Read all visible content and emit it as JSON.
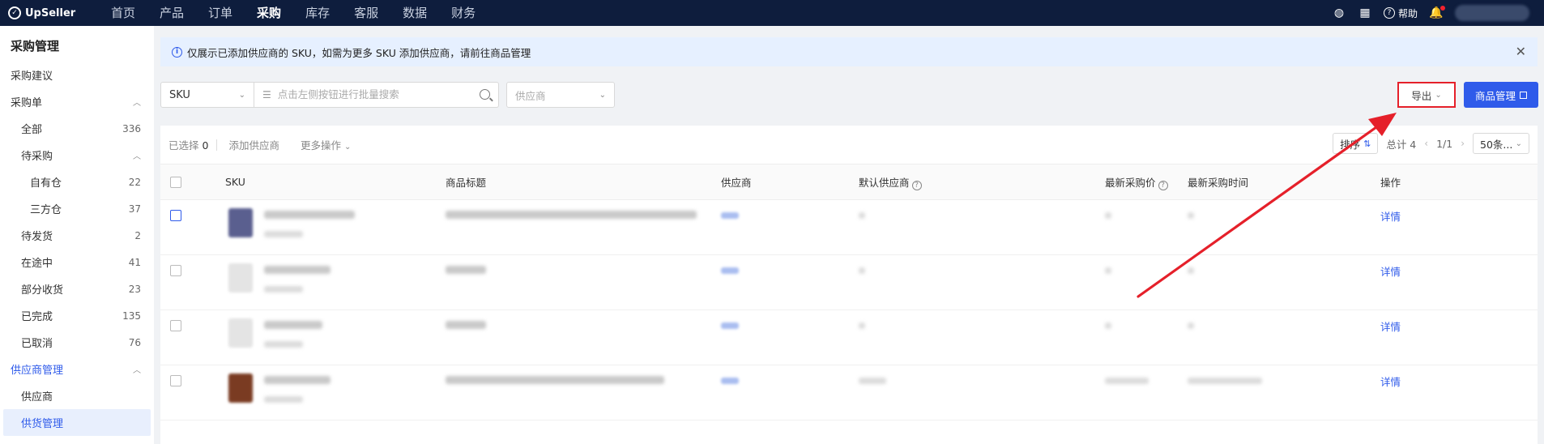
{
  "app": {
    "brand": "UpSeller"
  },
  "topnav": {
    "items": [
      "首页",
      "产品",
      "订单",
      "采购",
      "库存",
      "客服",
      "数据",
      "财务"
    ],
    "active_index": 3,
    "help_label": "帮助"
  },
  "sidebar": {
    "title": "采购管理",
    "items": [
      {
        "label": "采购建议",
        "count": "",
        "level": 1
      },
      {
        "label": "采购单",
        "count": "",
        "level": 1,
        "chevron": "up"
      },
      {
        "label": "全部",
        "count": "336",
        "level": 2
      },
      {
        "label": "待采购",
        "count": "",
        "level": 2,
        "chevron": "up"
      },
      {
        "label": "自有仓",
        "count": "22",
        "level": 3
      },
      {
        "label": "三方仓",
        "count": "37",
        "level": 3
      },
      {
        "label": "待发货",
        "count": "2",
        "level": 2
      },
      {
        "label": "在途中",
        "count": "41",
        "level": 2
      },
      {
        "label": "部分收货",
        "count": "23",
        "level": 2
      },
      {
        "label": "已完成",
        "count": "135",
        "level": 2
      },
      {
        "label": "已取消",
        "count": "76",
        "level": 2
      },
      {
        "label": "供应商管理",
        "count": "",
        "level": 1,
        "chevron": "up",
        "active_group": true
      },
      {
        "label": "供应商",
        "count": "",
        "level": 2
      },
      {
        "label": "供货管理",
        "count": "",
        "level": 2,
        "selected": true
      }
    ]
  },
  "notice": {
    "text": "仅展示已添加供应商的 SKU，如需为更多 SKU 添加供应商，请前往商品管理"
  },
  "filters": {
    "search_type": "SKU",
    "search_placeholder": "点击左侧按钮进行批量搜索",
    "supplier_placeholder": "供应商",
    "export_label": "导出",
    "product_mgmt_label": "商品管理"
  },
  "batch": {
    "selected_label": "已选择",
    "selected_count": "0",
    "add_supplier": "添加供应商",
    "more_actions": "更多操作"
  },
  "pager": {
    "sort_label": "排序",
    "total_label": "总计 4",
    "page": "1/1",
    "page_size": "50条..."
  },
  "table": {
    "columns": [
      "SKU",
      "商品标题",
      "供应商",
      "默认供应商",
      "最新采购价",
      "最新采购时间",
      "操作"
    ],
    "rows": [
      {
        "action": "详情",
        "thumb_color": "#5a5f8f",
        "checkbox_highlight": true
      },
      {
        "action": "详情",
        "thumb_color": "#e4e4e4",
        "checkbox_highlight": false
      },
      {
        "action": "详情",
        "thumb_color": "#e4e4e4",
        "checkbox_highlight": false
      },
      {
        "action": "详情",
        "thumb_color": "#7a3b22",
        "checkbox_highlight": false
      }
    ]
  },
  "colors": {
    "accent": "#2f5bea",
    "nav_bg": "#0e1d3d",
    "highlight_red": "#e5202a",
    "notice_bg": "#e6f0ff"
  }
}
